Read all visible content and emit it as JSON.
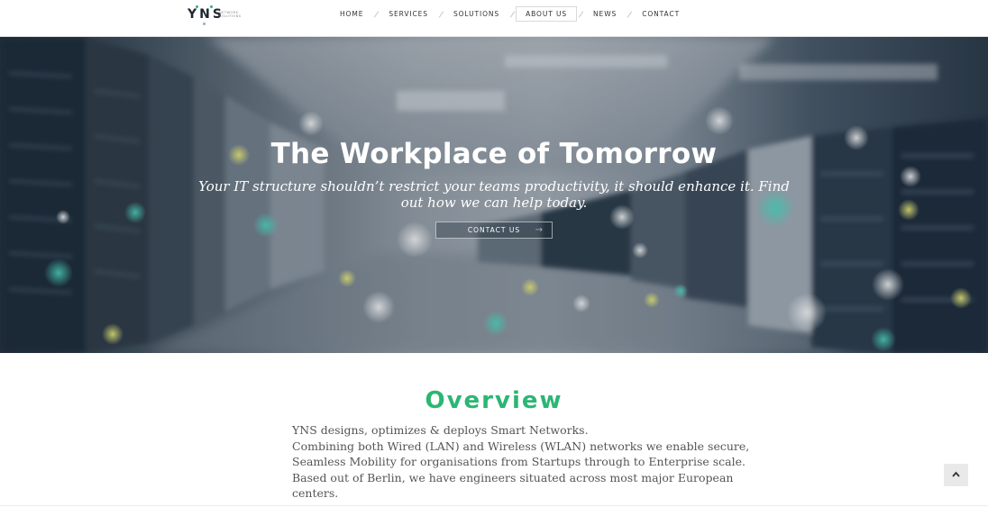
{
  "brand": {
    "logo_text": "YNS",
    "logo_sub": "NETWORK SOLUTIONS"
  },
  "nav": {
    "items": [
      {
        "label": "HOME"
      },
      {
        "label": "SERVICES"
      },
      {
        "label": "SOLUTIONS"
      },
      {
        "label": "ABOUT US"
      },
      {
        "label": "NEWS"
      },
      {
        "label": "CONTACT"
      }
    ],
    "active": "ABOUT US"
  },
  "hero": {
    "title": "The Workplace of Tomorrow",
    "subtitle": "Your IT structure shouldn’t restrict your teams productivity, it should enhance it. Find out how we can help today.",
    "button_label": "CONTACT US",
    "button_arrow": "→"
  },
  "overview": {
    "title": "Overview",
    "lines": [
      "YNS designs, optimizes & deploys Smart Networks.",
      "Combining both Wired (LAN) and Wireless (WLAN) networks we enable secure,",
      "Seamless Mobility for organisations from Startups through to Enterprise scale.",
      "Based out of Berlin, we have engineers situated across most major European",
      "centers."
    ]
  },
  "colors": {
    "accent": "#2bb673",
    "hero_dark": "#23313f",
    "logo_dark": "#1d2630"
  },
  "icons": {
    "scroll_top": "chevron-up-icon",
    "button_arrow": "arrow-right-icon"
  }
}
